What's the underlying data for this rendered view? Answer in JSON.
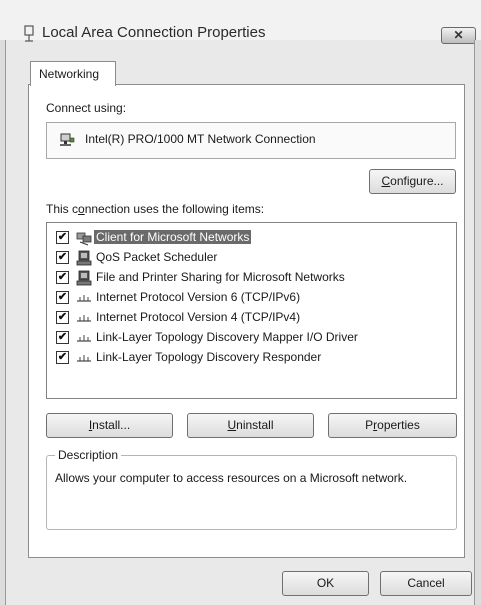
{
  "window": {
    "title": "Local Area Connection Properties",
    "close_glyph": "✕"
  },
  "tabs": [
    {
      "label": "Networking",
      "active": true
    }
  ],
  "connect_using": {
    "label": "Connect using:",
    "adapter": "Intel(R) PRO/1000 MT Network Connection",
    "configure_mnemonic": "C",
    "configure_rest": "onfigure..."
  },
  "items_section": {
    "label_before": "This c",
    "label_mnemonic": "o",
    "label_after": "nnection uses the following items:",
    "items": [
      {
        "label": "Client for Microsoft Networks",
        "checked": true,
        "icon": "client-icon",
        "selected": true
      },
      {
        "label": "QoS Packet Scheduler",
        "checked": true,
        "icon": "service-icon",
        "selected": false
      },
      {
        "label": "File and Printer Sharing for Microsoft Networks",
        "checked": true,
        "icon": "service-icon",
        "selected": false
      },
      {
        "label": "Internet Protocol Version 6 (TCP/IPv6)",
        "checked": true,
        "icon": "protocol-icon",
        "selected": false
      },
      {
        "label": "Internet Protocol Version 4 (TCP/IPv4)",
        "checked": true,
        "icon": "protocol-icon",
        "selected": false
      },
      {
        "label": "Link-Layer Topology Discovery Mapper I/O Driver",
        "checked": true,
        "icon": "protocol-icon",
        "selected": false
      },
      {
        "label": "Link-Layer Topology Discovery Responder",
        "checked": true,
        "icon": "protocol-icon",
        "selected": false
      }
    ],
    "check_glyph": "✔"
  },
  "actions": {
    "install_mnemonic": "I",
    "install_rest": "nstall...",
    "uninstall_mnemonic": "U",
    "uninstall_rest": "ninstall",
    "properties_before": "P",
    "properties_mnemonic": "r",
    "properties_after": "operties"
  },
  "description": {
    "legend": "Description",
    "text": "Allows your computer to access resources on a Microsoft network."
  },
  "footer": {
    "ok": "OK",
    "cancel": "Cancel"
  },
  "colors": {
    "selection": "#6a6a6a",
    "panel": "#ffffff",
    "chrome": "#e9e9e9"
  }
}
